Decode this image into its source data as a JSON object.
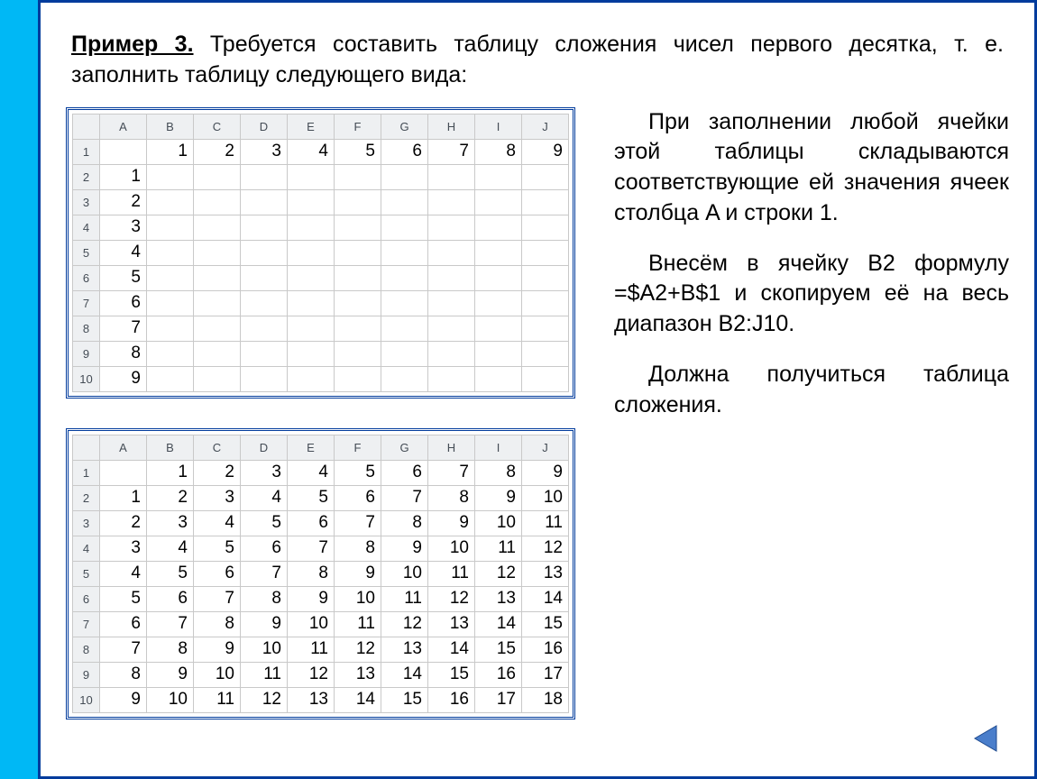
{
  "intro": {
    "title": "Пример 3.",
    "text": " Требуется составить таблицу сложения чисел первого десятка, т. е. заполнить таблицу следующего вида:"
  },
  "para1": "При заполнении любой ячейки этой таблицы складываются соответствующие ей значения ячеек столбца A и строки 1.",
  "para2": "Внесём в ячейку B2 формулу =$A2+B$1 и скопируем её на весь диапазон B2:J10.",
  "para3": "Должна получиться таблица сложения.",
  "columns": [
    "A",
    "B",
    "C",
    "D",
    "E",
    "F",
    "G",
    "H",
    "I",
    "J"
  ],
  "rowNums": [
    "1",
    "2",
    "3",
    "4",
    "5",
    "6",
    "7",
    "8",
    "9",
    "10"
  ],
  "table1": {
    "rows": [
      [
        "",
        "1",
        "2",
        "3",
        "4",
        "5",
        "6",
        "7",
        "8",
        "9"
      ],
      [
        "1",
        "",
        "",
        "",
        "",
        "",
        "",
        "",
        "",
        ""
      ],
      [
        "2",
        "",
        "",
        "",
        "",
        "",
        "",
        "",
        "",
        ""
      ],
      [
        "3",
        "",
        "",
        "",
        "",
        "",
        "",
        "",
        "",
        ""
      ],
      [
        "4",
        "",
        "",
        "",
        "",
        "",
        "",
        "",
        "",
        ""
      ],
      [
        "5",
        "",
        "",
        "",
        "",
        "",
        "",
        "",
        "",
        ""
      ],
      [
        "6",
        "",
        "",
        "",
        "",
        "",
        "",
        "",
        "",
        ""
      ],
      [
        "7",
        "",
        "",
        "",
        "",
        "",
        "",
        "",
        "",
        ""
      ],
      [
        "8",
        "",
        "",
        "",
        "",
        "",
        "",
        "",
        "",
        ""
      ],
      [
        "9",
        "",
        "",
        "",
        "",
        "",
        "",
        "",
        "",
        ""
      ]
    ]
  },
  "table2": {
    "rows": [
      [
        "",
        "1",
        "2",
        "3",
        "4",
        "5",
        "6",
        "7",
        "8",
        "9"
      ],
      [
        "1",
        "2",
        "3",
        "4",
        "5",
        "6",
        "7",
        "8",
        "9",
        "10"
      ],
      [
        "2",
        "3",
        "4",
        "5",
        "6",
        "7",
        "8",
        "9",
        "10",
        "11"
      ],
      [
        "3",
        "4",
        "5",
        "6",
        "7",
        "8",
        "9",
        "10",
        "11",
        "12"
      ],
      [
        "4",
        "5",
        "6",
        "7",
        "8",
        "9",
        "10",
        "11",
        "12",
        "13"
      ],
      [
        "5",
        "6",
        "7",
        "8",
        "9",
        "10",
        "11",
        "12",
        "13",
        "14"
      ],
      [
        "6",
        "7",
        "8",
        "9",
        "10",
        "11",
        "12",
        "13",
        "14",
        "15"
      ],
      [
        "7",
        "8",
        "9",
        "10",
        "11",
        "12",
        "13",
        "14",
        "15",
        "16"
      ],
      [
        "8",
        "9",
        "10",
        "11",
        "12",
        "13",
        "14",
        "15",
        "16",
        "17"
      ],
      [
        "9",
        "10",
        "11",
        "12",
        "13",
        "14",
        "15",
        "16",
        "17",
        "18"
      ]
    ]
  },
  "navIcon": "back-triangle"
}
